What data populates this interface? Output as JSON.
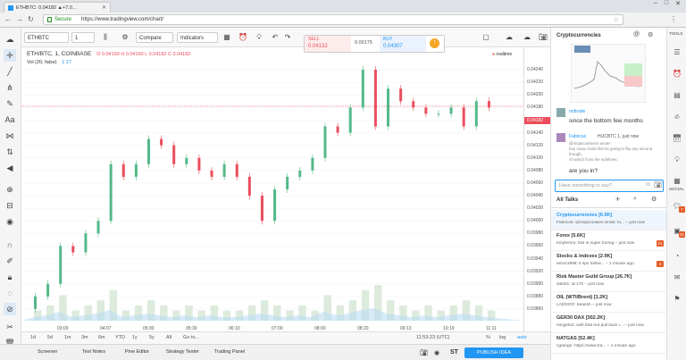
{
  "browser": {
    "tab_title": "ETHBTC: 0.04182 ▲+7.0…",
    "security_label": "Secure",
    "url": "https://www.tradingview.com/chart/"
  },
  "toolbar": {
    "symbol": "ETHBTC",
    "interval": "1",
    "compare_label": "Compare",
    "indicators_label": "Indicators"
  },
  "trade": {
    "sell_label": "SELL",
    "sell_price": "0.04132",
    "spread": "0.00175",
    "buy_label": "BUY",
    "buy_price": "0.04307"
  },
  "chart": {
    "symbol_line": "ETH/BTC, 1, COINBASE",
    "ohlc": "O 0.04190  H 0.04190  L 0.04182  C 0.04182",
    "volume_legend": "Vol (20, false)",
    "volume_values": "1  17",
    "realtime_label": "realtime",
    "current_price": "0.04182",
    "colors": {
      "up": "#53b987",
      "down": "#eb4d5c",
      "price_line": "#eb4d5c"
    }
  },
  "chart_data": {
    "type": "candlestick",
    "title": "ETH/BTC, 1, COINBASE",
    "y_ticks": [
      "0.04240",
      "0.04220",
      "0.04200",
      "0.04180",
      "0.04160",
      "0.04140",
      "0.04120",
      "0.04100",
      "0.04080",
      "0.04060",
      "0.04040",
      "0.04020",
      "0.04000",
      "0.03980",
      "0.03960",
      "0.03940",
      "0.03920",
      "0.03900",
      "0.03880",
      "0.03860"
    ],
    "x_ticks": [
      "03:00",
      "04:07",
      "05:00",
      "05:30",
      "06:10",
      "07:00",
      "08:00",
      "08:20",
      "09:13",
      "10:19",
      "11:11"
    ],
    "ylim": [
      0.0385,
      0.0425
    ],
    "candles": [
      {
        "o": 0.0386,
        "c": 0.0388
      },
      {
        "o": 0.0388,
        "c": 0.039
      },
      {
        "o": 0.039,
        "c": 0.0396
      },
      {
        "o": 0.0396,
        "c": 0.0395
      },
      {
        "o": 0.0395,
        "c": 0.0398
      },
      {
        "o": 0.0398,
        "c": 0.04
      },
      {
        "o": 0.04,
        "c": 0.0409
      },
      {
        "o": 0.0409,
        "c": 0.0407
      },
      {
        "o": 0.0407,
        "c": 0.0409
      },
      {
        "o": 0.0409,
        "c": 0.0413
      },
      {
        "o": 0.0413,
        "c": 0.0412
      },
      {
        "o": 0.0412,
        "c": 0.0409
      },
      {
        "o": 0.0409,
        "c": 0.041
      },
      {
        "o": 0.041,
        "c": 0.0408
      },
      {
        "o": 0.0408,
        "c": 0.0407
      },
      {
        "o": 0.0407,
        "c": 0.0409
      },
      {
        "o": 0.0409,
        "c": 0.0407
      },
      {
        "o": 0.0407,
        "c": 0.0404
      },
      {
        "o": 0.0404,
        "c": 0.04
      },
      {
        "o": 0.04,
        "c": 0.0405
      },
      {
        "o": 0.0405,
        "c": 0.0407
      },
      {
        "o": 0.0407,
        "c": 0.0408
      },
      {
        "o": 0.0408,
        "c": 0.041
      },
      {
        "o": 0.041,
        "c": 0.0415
      },
      {
        "o": 0.0415,
        "c": 0.0414
      },
      {
        "o": 0.0414,
        "c": 0.0418
      },
      {
        "o": 0.0418,
        "c": 0.0424
      },
      {
        "o": 0.0424,
        "c": 0.0415
      },
      {
        "o": 0.0415,
        "c": 0.0421
      },
      {
        "o": 0.0421,
        "c": 0.0419
      },
      {
        "o": 0.0419,
        "c": 0.0418
      },
      {
        "o": 0.0418,
        "c": 0.0417
      },
      {
        "o": 0.0417,
        "c": 0.0417
      },
      {
        "o": 0.0417,
        "c": 0.0418
      },
      {
        "o": 0.0418,
        "c": 0.0415
      },
      {
        "o": 0.0415,
        "c": 0.0419
      },
      {
        "o": 0.0419,
        "c": 0.0418
      }
    ],
    "volume": [
      2,
      3,
      5,
      2,
      3,
      4,
      6,
      2,
      3,
      4,
      3,
      2,
      3,
      2,
      3,
      2,
      2,
      3,
      4,
      3,
      2,
      3,
      2,
      5,
      3,
      4,
      6,
      7,
      4,
      3,
      2,
      3,
      2,
      3,
      4,
      3,
      2
    ]
  },
  "bottom": {
    "ranges": [
      "1d",
      "5d",
      "1m",
      "3m",
      "6m",
      "YTD",
      "1y",
      "5y",
      "All",
      "Go to..."
    ],
    "clock": "11:53:23 (UTC)",
    "pct": "%",
    "log": "log",
    "auto": "auto"
  },
  "footer": {
    "tabs": [
      "Screener",
      "Text Notes",
      "Pine Editor",
      "Strategy Tester",
      "Trading Panel"
    ],
    "publish": "PUBLISH IDEA"
  },
  "panel": {
    "title": "Cryptocurrencies",
    "post1_user": "mdtrade",
    "post1_text": "since the bottom few months",
    "post2_user": "Fabricus",
    "post2_ref": "HUCBTC 1, just now",
    "post2_quote1": "@ninjacookie4m wrote:",
    "post2_quote2": "buy maxx looks like its going to flip any second though.",
    "post2_quote3": "Al watch from the sidelines.",
    "post2_text": "are you in?",
    "input_placeholder": "Have something to say?",
    "all_talks": "All Talks",
    "talks": [
      {
        "name": "Cryptocurrencies [6.9K]",
        "msg": "Fabricus: @ninjacookies wrote: fu... – just now",
        "count": ""
      },
      {
        "name": "Forex [5.6K]",
        "msg": "tonyfermo: this is super boring – just now",
        "count": "21"
      },
      {
        "name": "Stocks & Indexes [2.9K]",
        "msg": "amos1998: if spx follow... – 1 minute ago",
        "count": "3"
      },
      {
        "name": "Risk Master Guild Group [26.7K]",
        "msg": "safeti1: at 170 – just now",
        "count": ""
      },
      {
        "name": "OIL (WTI/Brent) [1.2K]",
        "msg": "LADDOO: bearish – just now",
        "count": ""
      },
      {
        "name": "GER30 DAX [302.2K]",
        "msg": "mingshut: with that red pull back i... – just now",
        "count": ""
      },
      {
        "name": "NATGAS [52.4K]",
        "msg": "cgrange: https://www.tra... – 1 minute ago",
        "count": ""
      }
    ]
  },
  "side": {
    "tools_label": "TOOLS",
    "social_label": "SOCIAL",
    "badge1": "7",
    "badge2": "21"
  }
}
